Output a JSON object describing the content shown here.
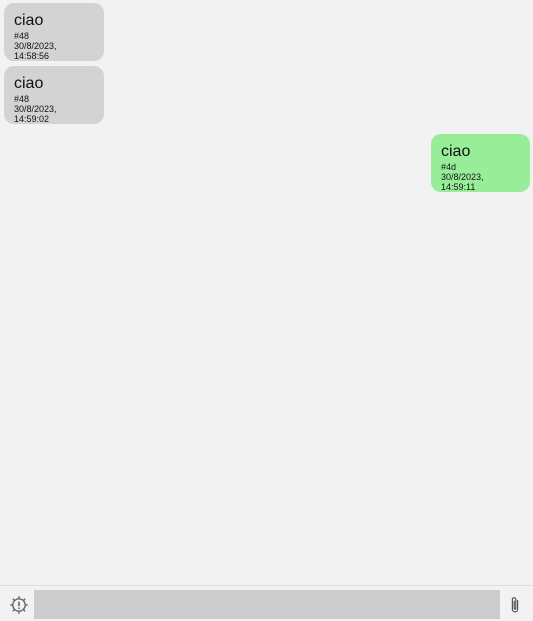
{
  "messages": [
    {
      "direction": "incoming",
      "text": "ciao",
      "sender": "#48",
      "timestamp": "30/8/2023, 14:58:56"
    },
    {
      "direction": "incoming",
      "text": "ciao",
      "sender": "#48",
      "timestamp": "30/8/2023, 14:59:02"
    },
    {
      "direction": "outgoing",
      "text": "ciao",
      "sender": "#4d",
      "timestamp": "30/8/2023, 14:59:11"
    }
  ],
  "composer": {
    "input_value": "",
    "left_icon": "alert-gear-icon",
    "right_icon": "paperclip-icon"
  },
  "colors": {
    "background": "#f2f2f2",
    "incoming_bubble": "#d3d3d3",
    "outgoing_bubble": "#98ee98",
    "input_background": "#cccccc"
  }
}
